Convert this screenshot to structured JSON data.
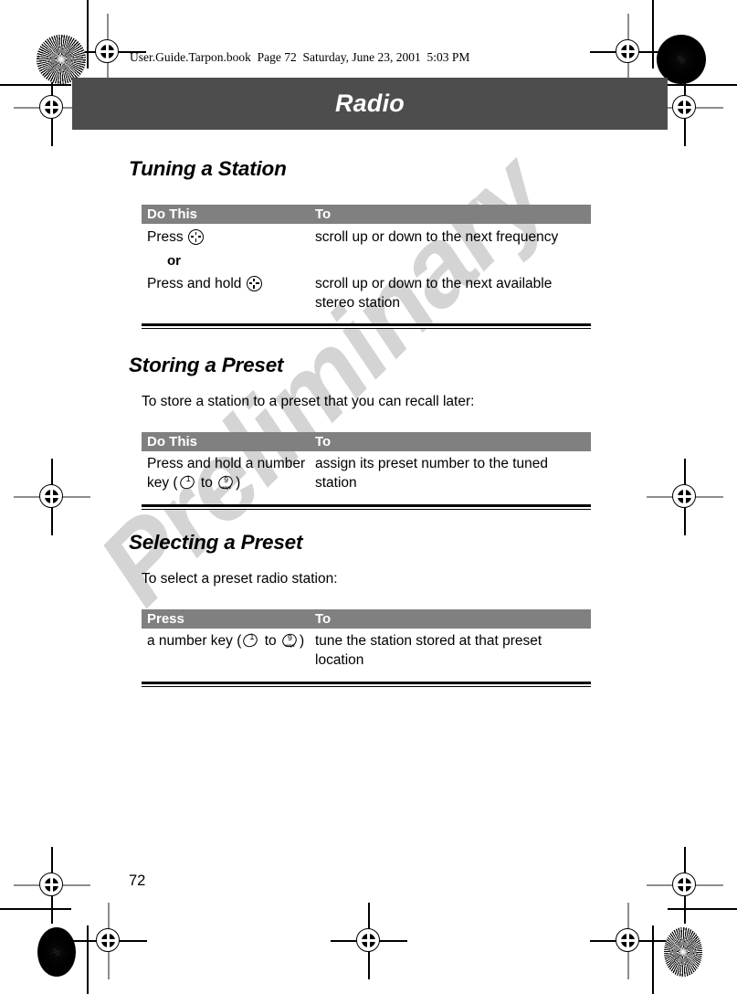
{
  "document": {
    "file_stamp": "User.Guide.Tarpon.book  Page 72  Saturday, June 23, 2001  5:03 PM",
    "chapter_title": "Radio",
    "page_number": "72",
    "watermark": "Preliminary",
    "colors": {
      "chapter_bar": "#4d4d4d",
      "table_header": "#808080",
      "watermark": "#d4d4d4",
      "text": "#000000"
    }
  },
  "sections": [
    {
      "heading": "Tuning a Station",
      "lead": null,
      "table": {
        "headers": [
          "Do This",
          "To"
        ],
        "rows": [
          {
            "do_prefix": "Press ",
            "do_icon": "navigation-key-icon",
            "do_suffix": "",
            "to": "scroll up or down to the next frequency",
            "separator": "or"
          },
          {
            "do_prefix": "Press and hold ",
            "do_icon": "navigation-key-icon",
            "do_suffix": "",
            "to": "scroll up or down to the next available stereo station",
            "separator": null
          }
        ]
      }
    },
    {
      "heading": "Storing a Preset",
      "lead": "To store a station to a preset that you can recall later:",
      "table": {
        "headers": [
          "Do This",
          "To"
        ],
        "rows": [
          {
            "do_prefix": "Press and hold a number",
            "do_line2_pre": "key (",
            "do_key_from": {
              "digit": "1",
              "letters": ""
            },
            "do_line2_mid": " to ",
            "do_key_to": {
              "digit": "9",
              "letters": "wxyz"
            },
            "do_line2_post": ")",
            "to": "assign its preset number to the tuned station",
            "separator": null
          }
        ]
      }
    },
    {
      "heading": "Selecting a Preset",
      "lead": "To select a preset radio station:",
      "table": {
        "headers": [
          "Press",
          "To"
        ],
        "rows": [
          {
            "do_line2_pre": "a number key (",
            "do_key_from": {
              "digit": "1",
              "letters": ""
            },
            "do_line2_mid": " to ",
            "do_key_to": {
              "digit": "9",
              "letters": "wxyz"
            },
            "do_line2_post": ")",
            "to": "tune the station stored at that preset location",
            "separator": null
          }
        ]
      }
    }
  ]
}
